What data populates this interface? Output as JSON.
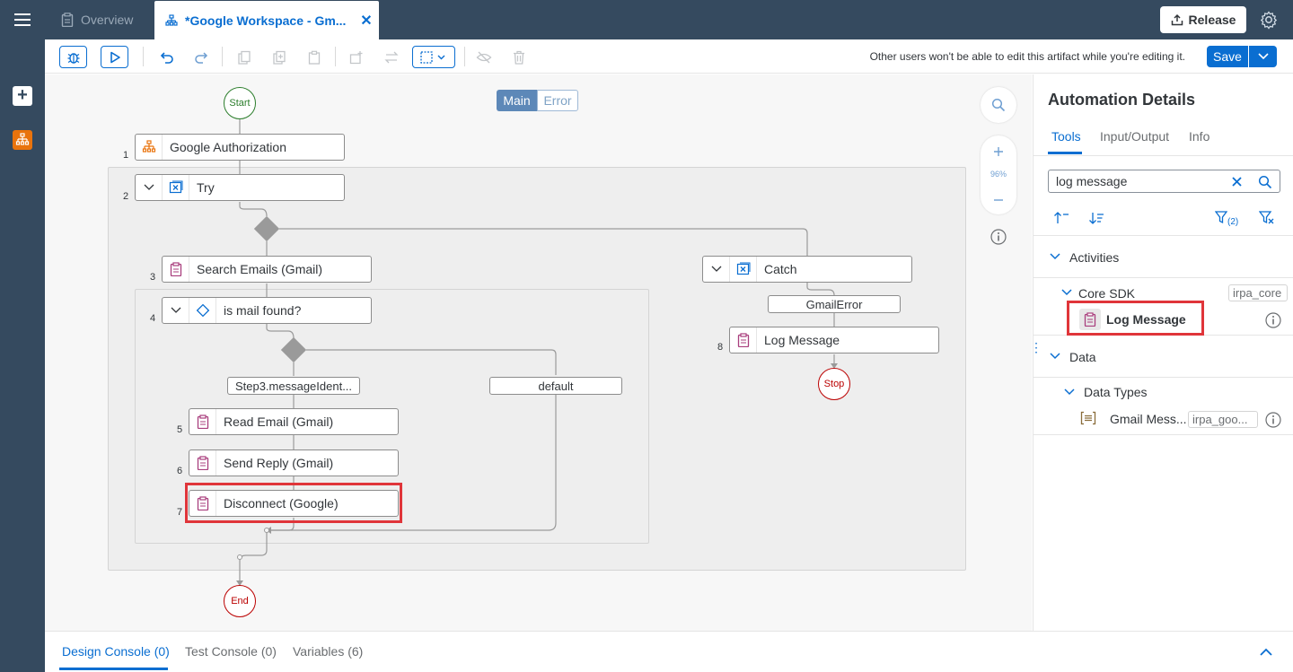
{
  "header": {
    "tabs": [
      {
        "label": "Overview",
        "icon": "clipboard-icon"
      },
      {
        "label": "*Google Workspace - Gm...",
        "icon": "automation-icon"
      }
    ],
    "release_label": "Release"
  },
  "toolbar": {
    "warning": "Other users won't be able to edit this artifact while you're editing it.",
    "save_label": "Save"
  },
  "canvas": {
    "view_tabs": {
      "main": "Main",
      "error": "Error"
    },
    "zoom": "96%",
    "start": "Start",
    "end": "End",
    "stop": "Stop",
    "steps": [
      {
        "no": "1",
        "label": "Google Authorization"
      },
      {
        "no": "2",
        "label": "Try"
      },
      {
        "no": "3",
        "label": "Search Emails (Gmail)"
      },
      {
        "no": "4",
        "label": "is mail found?"
      },
      {
        "no": "5",
        "label": "Read Email (Gmail)"
      },
      {
        "no": "6",
        "label": "Send Reply (Gmail)"
      },
      {
        "no": "7",
        "label": "Disconnect (Google)"
      },
      {
        "no": "8",
        "label": "Log Message"
      }
    ],
    "catch_label": "Catch",
    "conditions": {
      "step3": "Step3.messageIdent...",
      "default": "default",
      "gmail_error": "GmailError"
    }
  },
  "panel": {
    "title": "Automation Details",
    "tabs": [
      "Tools",
      "Input/Output",
      "Info"
    ],
    "search": {
      "value": "log message"
    },
    "filter_count": "(2)",
    "activities_label": "Activities",
    "core_sdk_label": "Core SDK",
    "core_sdk_tag": "irpa_core",
    "log_message_label": "Log Message",
    "data_label": "Data",
    "data_types_label": "Data Types",
    "gmail_label": "Gmail Mess...",
    "gmail_tag": "irpa_goo..."
  },
  "console": {
    "tabs": [
      "Design Console (0)",
      "Test Console (0)",
      "Variables (6)"
    ]
  },
  "colors": {
    "accent": "#0a6ed1",
    "shell": "#354a5f",
    "highlight": "#e0353a",
    "start": "#2b7d2b",
    "end": "#bb0000"
  }
}
